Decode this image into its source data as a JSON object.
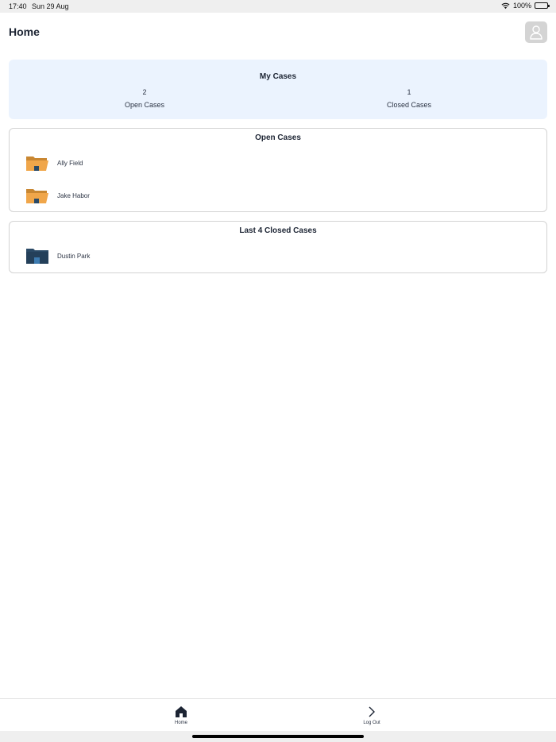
{
  "status_bar": {
    "time": "17:40",
    "date": "Sun 29 Aug",
    "battery": "100%",
    "icons": [
      "wifi-icon",
      "battery-icon"
    ]
  },
  "header": {
    "title": "Home",
    "profile_icon": "user-icon"
  },
  "my_cases": {
    "title": "My Cases",
    "open_count": "2",
    "open_label": "Open Cases",
    "closed_count": "1",
    "closed_label": "Closed Cases"
  },
  "open_cases": {
    "title": "Open Cases",
    "icon": "open-folder-icon",
    "items": [
      {
        "name": "Ally Field"
      },
      {
        "name": "Jake Habor"
      }
    ]
  },
  "closed_cases": {
    "title": "Last 4 Closed Cases",
    "icon": "closed-folder-icon",
    "items": [
      {
        "name": "Dustin Park"
      }
    ]
  },
  "tab_bar": {
    "home_label": "Home",
    "logout_label": "Log Out"
  },
  "colors": {
    "panel_bg": "#ebf3fe",
    "folder_open": "#f0a64a",
    "folder_closed": "#2b4a66",
    "text_dark": "#1c2433"
  }
}
